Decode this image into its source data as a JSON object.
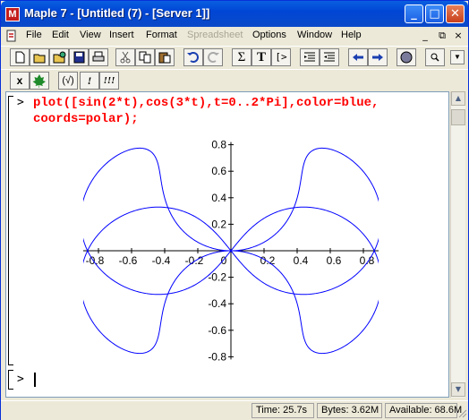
{
  "window": {
    "app_icon_letter": "M",
    "title": "Maple 7  - [Untitled (7) - [Server 1]]",
    "controls": {
      "minimize": "_",
      "maximize": "□",
      "close": "✕"
    }
  },
  "menu": {
    "items": [
      {
        "label": "File",
        "enabled": true
      },
      {
        "label": "Edit",
        "enabled": true
      },
      {
        "label": "View",
        "enabled": true
      },
      {
        "label": "Insert",
        "enabled": true
      },
      {
        "label": "Format",
        "enabled": true
      },
      {
        "label": "Spreadsheet",
        "enabled": false
      },
      {
        "label": "Options",
        "enabled": true
      },
      {
        "label": "Window",
        "enabled": true
      },
      {
        "label": "Help",
        "enabled": true
      }
    ],
    "mdi_controls": {
      "minimize": "_",
      "restore": "⧉",
      "close": "×"
    }
  },
  "toolbar1": {
    "icons": [
      "new-icon",
      "open-icon",
      "open-url-icon",
      "save-icon",
      "print-icon",
      "cut-icon",
      "copy-icon",
      "paste-icon",
      "undo-icon",
      "redo-icon",
      "sigma-icon",
      "text-icon",
      "input-prompt-icon",
      "indent-icon",
      "outdent-icon",
      "back-icon",
      "forward-icon",
      "stop-icon",
      "zoom-icon"
    ],
    "labels": {
      "sigma": "Σ",
      "text": "T",
      "prompt": "[>"
    }
  },
  "toolbar2": {
    "buttons": [
      {
        "name": "interrupt-button",
        "label": "x"
      },
      {
        "name": "maple-leaf-button",
        "label": "🍁"
      },
      {
        "name": "check-syntax-button",
        "label": "(√)"
      },
      {
        "name": "execute-button",
        "label": "!"
      },
      {
        "name": "execute-all-button",
        "label": "!!!"
      }
    ]
  },
  "document": {
    "prompt": ">",
    "command_line1": "plot([sin(2*t),cos(3*t),t=0..2*Pi],color=blue,",
    "command_line2": "coords=polar);",
    "empty_prompt": ">"
  },
  "chart_data": {
    "type": "line",
    "description_source": "parametric polar plot r=sin(2t), theta=cos(3t)",
    "x_ticks": [
      "-0.8",
      "-0.6",
      "-0.4",
      "-0.2",
      "0",
      "0.2",
      "0.4",
      "0.6",
      "0.8"
    ],
    "y_ticks": [
      "0.8",
      "0.6",
      "0.4",
      "0.2",
      "-0.2",
      "-0.4",
      "-0.6",
      "-0.8"
    ],
    "xlim": [
      -0.9,
      0.9
    ],
    "ylim": [
      -0.82,
      0.82
    ],
    "series": [
      {
        "color": "#0000ff",
        "expression": "r=sin(2t), theta=cos(3t), t in [0, 2pi]"
      }
    ]
  },
  "status": {
    "time": "Time:  25.7s",
    "bytes": "Bytes: 3.62M",
    "available": "Available: 68.6M"
  },
  "colors": {
    "title_bar": "#0a5fe0",
    "command": "#ff0000",
    "plot": "#0000ff"
  }
}
